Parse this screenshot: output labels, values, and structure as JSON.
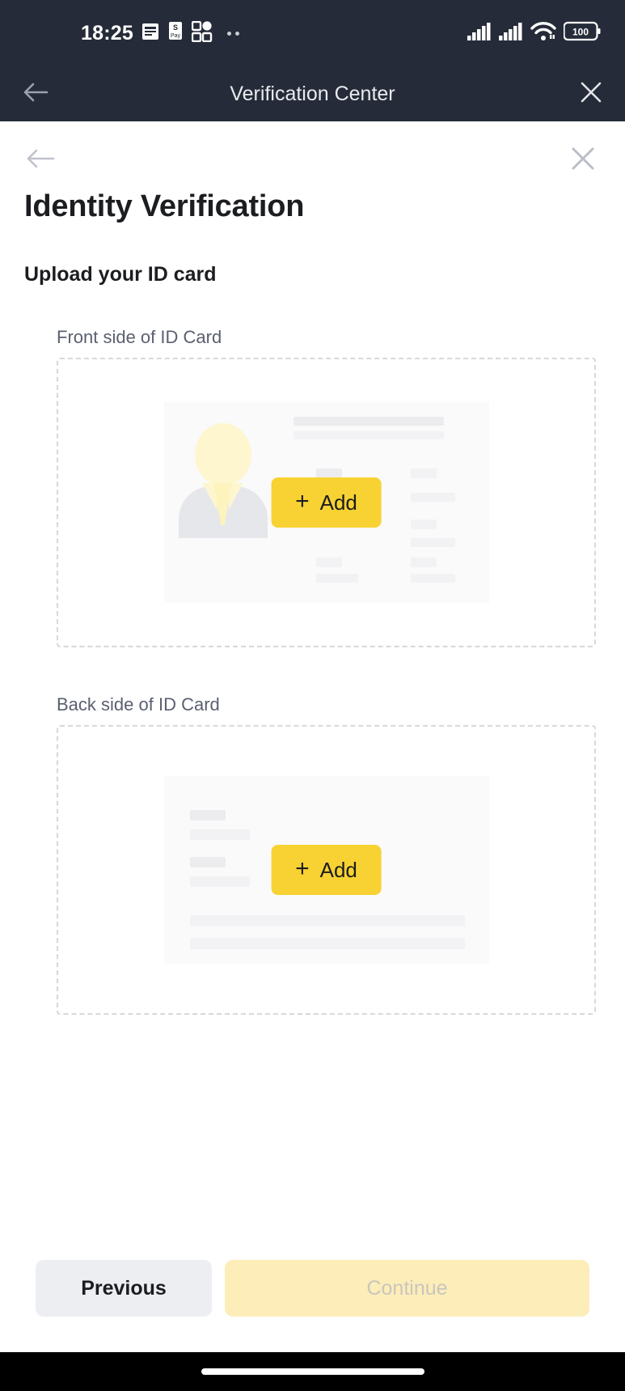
{
  "status_bar": {
    "time": "18:25",
    "left_icons": [
      "notes-icon",
      "samsung-pay-icon",
      "app-grid-icon",
      "more-dots-icon"
    ],
    "right_icons": [
      "signal-sim1-icon",
      "signal-sim2-icon",
      "wifi-icon",
      "battery-icon"
    ],
    "battery_level": "100",
    "background_color": "#252b38"
  },
  "app_header": {
    "title": "Verification Center",
    "back_icon": "arrow-left-icon",
    "close_icon": "close-icon",
    "background_color": "#252b38"
  },
  "page_nav": {
    "back_icon": "arrow-left-icon",
    "close_icon": "close-icon"
  },
  "page": {
    "title": "Identity Verification",
    "section_title": "Upload your ID card"
  },
  "uploads": [
    {
      "label": "Front side of ID Card",
      "add_label": "Add",
      "add_icon": "plus-icon",
      "card_type": "front"
    },
    {
      "label": "Back side of ID Card",
      "add_label": "Add",
      "add_icon": "plus-icon",
      "card_type": "back"
    }
  ],
  "footer": {
    "previous_label": "Previous",
    "continue_label": "Continue",
    "continue_disabled": true
  },
  "colors": {
    "accent_yellow": "#f8d232",
    "accent_yellow_disabled": "#fcedb9",
    "header_dark": "#252b38",
    "text_primary": "#1c1d21",
    "text_secondary": "#5b6070"
  }
}
